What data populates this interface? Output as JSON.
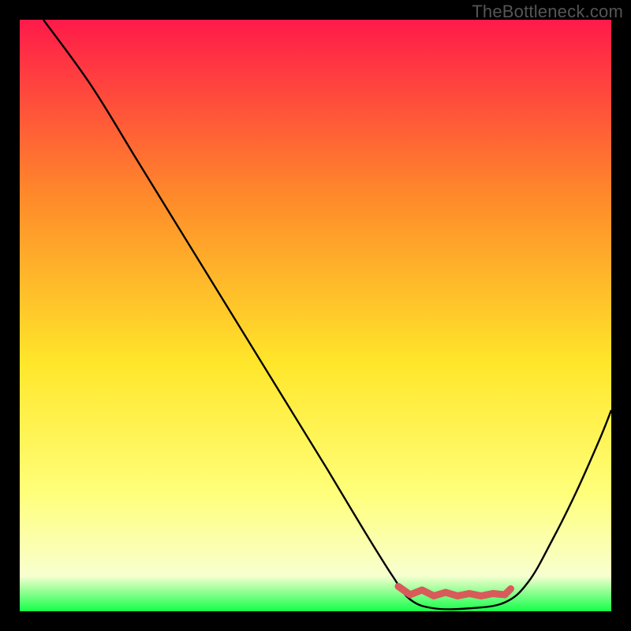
{
  "watermark": "TheBottleneck.com",
  "chart_data": {
    "type": "line",
    "title": "",
    "xlabel": "",
    "ylabel": "",
    "xlim": [
      0,
      100
    ],
    "ylim": [
      0,
      100
    ],
    "gradient_background": {
      "top": "#ff1a4a",
      "mid_upper": "#ff8a2a",
      "mid": "#ffe62a",
      "mid_lower": "#ffff7a",
      "low": "#f8ffcf",
      "bottom": "#14ff4a"
    },
    "series": [
      {
        "name": "curve",
        "stroke": "#000000",
        "points": [
          {
            "x": 4,
            "y": 100
          },
          {
            "x": 12,
            "y": 89
          },
          {
            "x": 20,
            "y": 76
          },
          {
            "x": 28,
            "y": 63
          },
          {
            "x": 36,
            "y": 50
          },
          {
            "x": 44,
            "y": 37
          },
          {
            "x": 52,
            "y": 24
          },
          {
            "x": 58,
            "y": 14
          },
          {
            "x": 63,
            "y": 6
          },
          {
            "x": 66,
            "y": 2
          },
          {
            "x": 70,
            "y": 0.5
          },
          {
            "x": 76,
            "y": 0.5
          },
          {
            "x": 82,
            "y": 1.5
          },
          {
            "x": 86,
            "y": 5
          },
          {
            "x": 90,
            "y": 12
          },
          {
            "x": 94,
            "y": 20
          },
          {
            "x": 98,
            "y": 29
          },
          {
            "x": 100,
            "y": 34
          }
        ]
      },
      {
        "name": "highlight-band",
        "stroke": "#d85a5a",
        "stroke_width": 9,
        "points": [
          {
            "x": 64,
            "y": 4.2
          },
          {
            "x": 66,
            "y": 2.8
          },
          {
            "x": 68,
            "y": 3.6
          },
          {
            "x": 70,
            "y": 2.6
          },
          {
            "x": 72,
            "y": 3.2
          },
          {
            "x": 74,
            "y": 2.6
          },
          {
            "x": 76,
            "y": 3.0
          },
          {
            "x": 78,
            "y": 2.6
          },
          {
            "x": 80,
            "y": 3.0
          },
          {
            "x": 82,
            "y": 2.8
          },
          {
            "x": 83,
            "y": 3.8
          }
        ]
      }
    ]
  }
}
